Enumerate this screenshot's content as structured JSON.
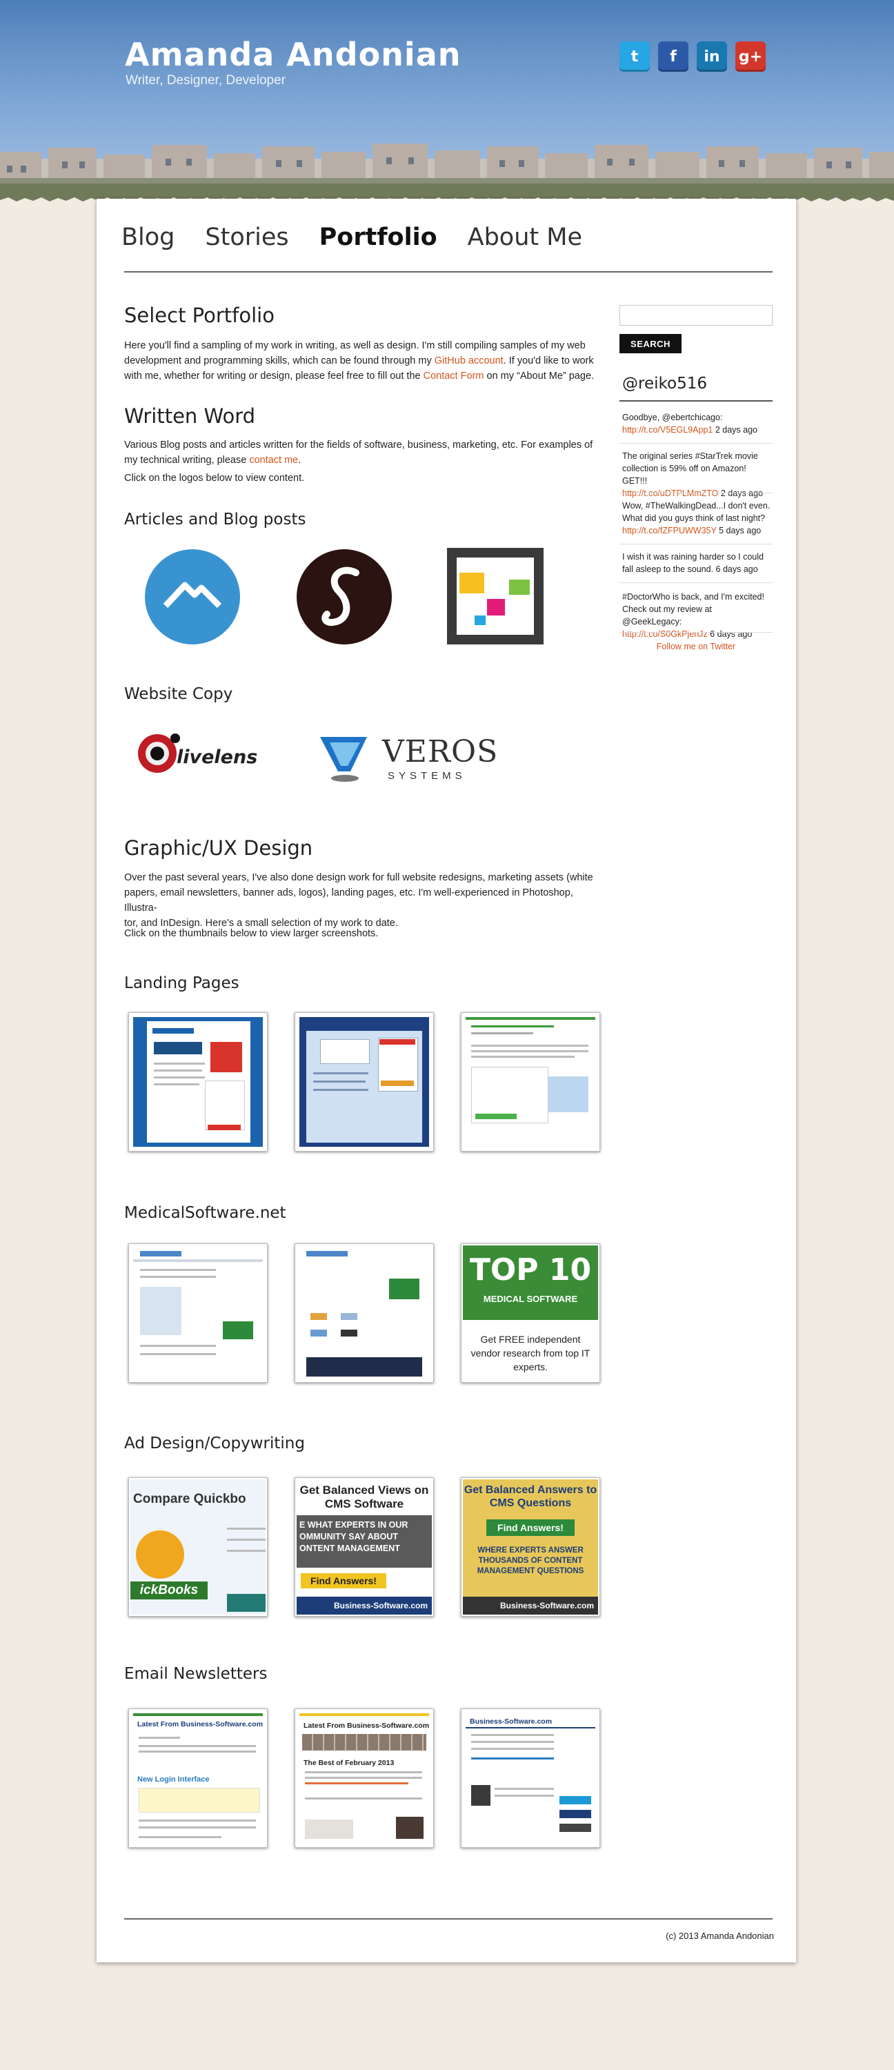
{
  "header": {
    "title": "Amanda Andonian",
    "tagline": "Writer, Designer, Developer",
    "social": [
      {
        "name": "twitter-icon",
        "glyph": "t",
        "color": "#28a5e3"
      },
      {
        "name": "facebook-icon",
        "glyph": "f",
        "color": "#2d5aa8"
      },
      {
        "name": "linkedin-icon",
        "glyph": "in",
        "color": "#1a78b1"
      },
      {
        "name": "googleplus-icon",
        "glyph": "g+",
        "color": "#d3362b"
      }
    ]
  },
  "nav": {
    "items": [
      "Blog",
      "Stories",
      "Portfolio",
      "About Me"
    ],
    "active": "Portfolio"
  },
  "main": {
    "select_title": "Select Portfolio",
    "intro_1": "Here you'll find a sampling of my work in writing, as well as design. I'm still compiling samples of my web",
    "intro_2a": "development and programming skills, which can be found through my ",
    "intro_2_link": "GitHub account",
    "intro_2b": ". If you'd like to work",
    "intro_3a": "with me, whether for writing or design, please feel free to fill out the ",
    "intro_3_link": "Contact Form",
    "intro_3b": " on my “About Me” page.",
    "written_title": "Written Word",
    "written_1": "Various Blog posts and articles written for the fields of software, business, marketing, etc. For examples of",
    "written_2a": "my technical writing, please ",
    "written_2_link": "contact me",
    "written_2b": ".",
    "written_3": "Click on the logos below to view content.",
    "articles_title": "Articles and Blog posts",
    "website_copy_title": "Website Copy",
    "livelens_label": "livelens",
    "veros_label": "VEROS",
    "veros_sub": "SYSTEMS",
    "design_title": "Graphic/UX Design",
    "design_1": "Over the past several years, I've also done design work for full website redesigns, marketing assets (white",
    "design_2": "papers, email newsletters, banner ads, logos), landing pages, etc. I'm well-experienced in Photoshop, Illustra-",
    "design_3": "tor, and InDesign. Here's a small selection of my work to date.",
    "design_4": "Click on the thumbnails below to view larger screenshots.",
    "landing_title": "Landing Pages",
    "medical_title": "MedicalSoftware.net",
    "ad_title": "Ad Design/Copywriting",
    "newsletters_title": "Email Newsletters",
    "medical_thumb3": {
      "big": "TOP 10",
      "sub": "MEDICAL SOFTWARE",
      "body": "Get FREE independent vendor research from top IT experts."
    },
    "ad_thumb1": {
      "head": "Compare Quickbo",
      "brand": "ickBooks"
    },
    "ad_thumb2": {
      "head": "Get Balanced Views on CMS Software",
      "mid": "E WHAT EXPERTS IN OUR OMMUNITY SAY ABOUT ONTENT MANAGEMENT",
      "cta": "Find Answers!",
      "brand": "Business-Software.com"
    },
    "ad_thumb3": {
      "head": "Get Balanced Answers to CMS Questions",
      "cta": "Find Answers!",
      "mid": "WHERE EXPERTS ANSWER THOUSANDS OF CONTENT MANAGEMENT QUESTIONS",
      "brand": "Business-Software.com"
    },
    "nl_thumb1": {
      "head": "Latest From Business-Software.com",
      "sub": "New Login Interface"
    },
    "nl_thumb2": {
      "head": "Latest From Business-Software.com",
      "sub": "The Best of February 2013"
    },
    "nl_thumb3": {
      "head": "Business-Software.com"
    }
  },
  "sidebar": {
    "search_button": "SEARCH",
    "twitter_handle": "@reiko516",
    "tweets": [
      {
        "text": "Goodbye, @ebertchicago:",
        "link": "http://t.co/V5EGL9App1",
        "time": "2 days ago"
      },
      {
        "text": "The original series #StarTrek movie collection is 59% off on Amazon! GET!!!",
        "link": "http://t.co/uDTPLMmZTO",
        "time": "2 days ago"
      },
      {
        "text": "Wow, #TheWalkingDead...I don't even. What did you guys think of last night?",
        "link": "http://t.co/fZFPUWW35Y",
        "time": "5 days ago"
      },
      {
        "text": "I wish it was raining harder so I could fall asleep to the sound.",
        "link": "",
        "time": "6 days ago"
      },
      {
        "text": "#DoctorWho is back, and I'm excited! Check out my review at @GeekLegacy:",
        "link": "http://t.co/S0GkPjenJz",
        "time": "6 days ago"
      }
    ],
    "follow": "Follow me on Twitter"
  },
  "footer": {
    "copyright": "(c) 2013 Amanda Andonian"
  }
}
